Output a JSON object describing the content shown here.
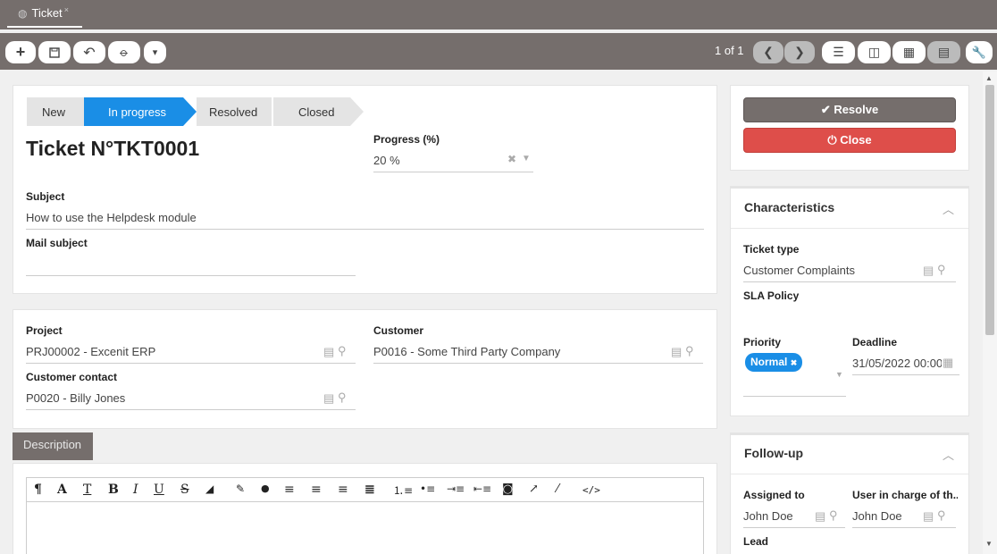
{
  "tab": {
    "icon": "globe-icon",
    "label": "Ticket",
    "close": "×"
  },
  "toolbar": {
    "new_icon": "+",
    "save_icon": "💾",
    "undo_icon": "↶",
    "attach_icon": "📎",
    "more_icon": "▾",
    "pager": "1 of 1",
    "prev_icon": "❮",
    "next_icon": "❯",
    "list_icon": "☰",
    "split_icon": "◫",
    "calendar_icon": "▦",
    "form_icon": "▤",
    "tools_icon": "🔧"
  },
  "steps": [
    "New",
    "In progress",
    "Resolved",
    "Closed"
  ],
  "title": "Ticket N°TKT0001",
  "progress": {
    "label": "Progress (%)",
    "value": "20 %"
  },
  "subject": {
    "label": "Subject",
    "value": "How to use the Helpdesk module"
  },
  "mail_subject": {
    "label": "Mail subject",
    "value": ""
  },
  "project": {
    "label": "Project",
    "value": "PRJ00002 - Excenit ERP"
  },
  "customer": {
    "label": "Customer",
    "value": "P0016 - Some Third Party Company"
  },
  "customer_contact": {
    "label": "Customer contact",
    "value": "P0020 - Billy Jones"
  },
  "description_tab": "Description",
  "editor_tools": [
    "¶",
    "A",
    "T",
    "B",
    "I",
    "U",
    "S",
    "⌫",
    "🖌",
    "💧",
    "≡",
    "≡",
    "≡",
    "≡",
    "⒈",
    "•",
    "⇥",
    "⇤",
    "📷",
    "↗",
    "✎",
    "</>"
  ],
  "actions": {
    "resolve": "✔ Resolve",
    "close": "⏻ Close"
  },
  "characteristics": {
    "title": "Characteristics",
    "ticket_type_label": "Ticket type",
    "ticket_type": "Customer Complaints",
    "sla_label": "SLA Policy",
    "priority_label": "Priority",
    "priority": "Normal",
    "deadline_label": "Deadline",
    "deadline": "31/05/2022 00:00"
  },
  "followup": {
    "title": "Follow-up",
    "assigned_label": "Assigned to",
    "assigned": "John Doe",
    "user_label": "User in charge of th...",
    "user": "John Doe",
    "lead_label": "Lead"
  },
  "colors": {
    "accent": "#1a8ee6",
    "danger": "#de4e4a",
    "header": "#756e6c"
  }
}
